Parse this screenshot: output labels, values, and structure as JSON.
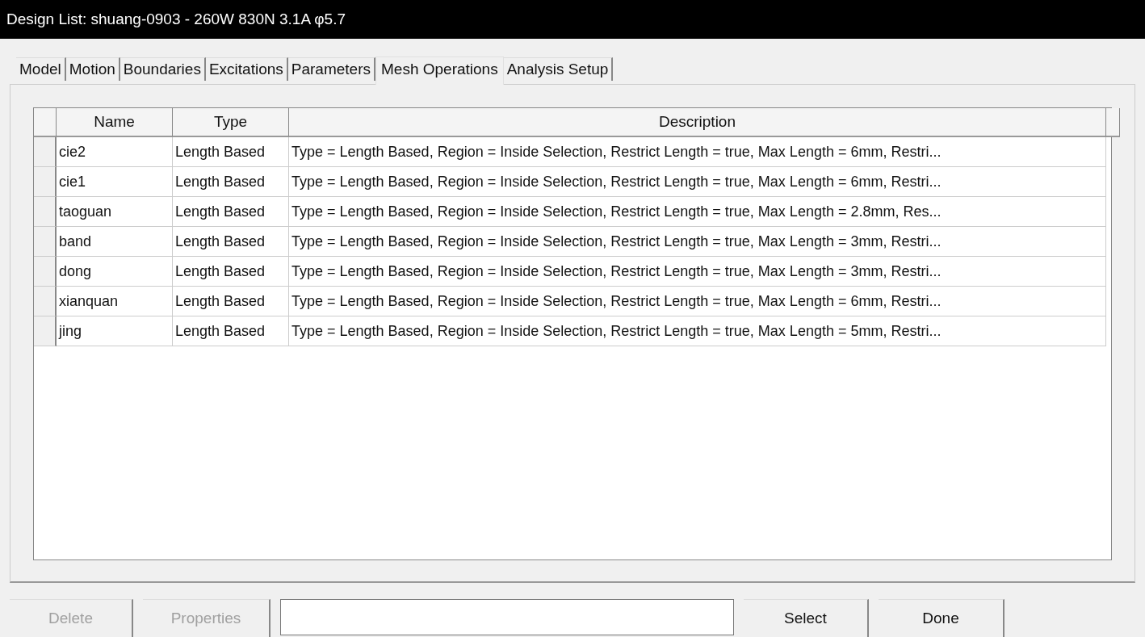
{
  "window": {
    "title": "Design List: shuang-0903 - 260W 830N 3.1A φ5.7"
  },
  "tabs": [
    {
      "label": "Model",
      "selected": false
    },
    {
      "label": "Motion",
      "selected": false
    },
    {
      "label": "Boundaries",
      "selected": false
    },
    {
      "label": "Excitations",
      "selected": false
    },
    {
      "label": "Parameters",
      "selected": false
    },
    {
      "label": "Mesh Operations",
      "selected": true
    },
    {
      "label": "Analysis Setup",
      "selected": false
    }
  ],
  "table": {
    "columns": [
      "Name",
      "Type",
      "Description"
    ],
    "rows": [
      {
        "name": "cie2",
        "type": "Length Based",
        "description": "Type = Length Based, Region = Inside Selection, Restrict Length = true, Max Length = 6mm, Restri..."
      },
      {
        "name": "cie1",
        "type": "Length Based",
        "description": "Type = Length Based, Region = Inside Selection, Restrict Length = true, Max Length = 6mm, Restri..."
      },
      {
        "name": "taoguan",
        "type": "Length Based",
        "description": "Type = Length Based, Region = Inside Selection, Restrict Length = true, Max Length = 2.8mm, Res..."
      },
      {
        "name": "band",
        "type": "Length Based",
        "description": "Type = Length Based, Region = Inside Selection, Restrict Length = true, Max Length = 3mm, Restri..."
      },
      {
        "name": "dong",
        "type": "Length Based",
        "description": "Type = Length Based, Region = Inside Selection, Restrict Length = true, Max Length = 3mm, Restri..."
      },
      {
        "name": "xianquan",
        "type": "Length Based",
        "description": "Type = Length Based, Region = Inside Selection, Restrict Length = true, Max Length = 6mm, Restri..."
      },
      {
        "name": "jing",
        "type": "Length Based",
        "description": "Type = Length Based, Region = Inside Selection, Restrict Length = true, Max Length = 5mm, Restri..."
      }
    ]
  },
  "buttons": [
    {
      "kind": "button",
      "label": "Delete",
      "disabled": true
    },
    {
      "kind": "button",
      "label": "Properties",
      "disabled": true
    },
    {
      "kind": "field"
    },
    {
      "kind": "button",
      "label": "Select",
      "disabled": false
    },
    {
      "kind": "button",
      "label": "Done",
      "disabled": false
    }
  ]
}
